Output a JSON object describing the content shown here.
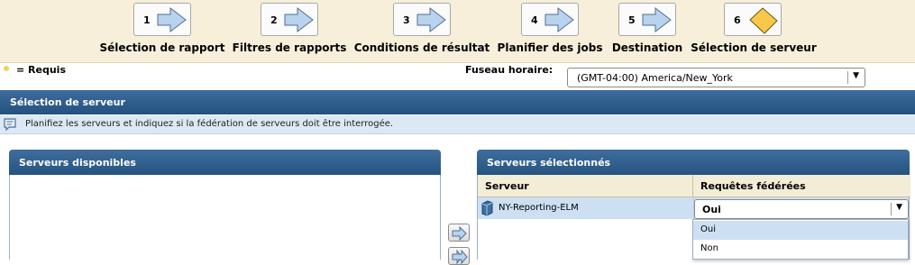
{
  "wizard": {
    "steps": [
      {
        "number": "1",
        "label": "Sélection de rapport",
        "state": "done"
      },
      {
        "number": "2",
        "label": "Filtres de rapports",
        "state": "done"
      },
      {
        "number": "3",
        "label": "Conditions de résultat",
        "state": "done"
      },
      {
        "number": "4",
        "label": "Planifier des jobs",
        "state": "done"
      },
      {
        "number": "5",
        "label": "Destination",
        "state": "done"
      },
      {
        "number": "6",
        "label": "Sélection de serveur",
        "state": "current"
      }
    ]
  },
  "required_legend": "= Requis",
  "timezone": {
    "label": "Fuseau horaire:",
    "value": "(GMT-04:00) America/New_York"
  },
  "section": {
    "title": "Sélection de serveur",
    "hint": "Planifiez les serveurs et indiquez si la fédération de serveurs doit être interrogée."
  },
  "available_servers": {
    "title": "Serveurs disponibles",
    "items": []
  },
  "selected_servers": {
    "title": "Serveurs sélectionnés",
    "columns": {
      "server": "Serveur",
      "federated": "Requêtes fédérées"
    },
    "rows": [
      {
        "server": "NY-Reporting-ELM",
        "federated": "Oui"
      }
    ],
    "federated_options": [
      "Oui",
      "Non"
    ]
  },
  "colors": {
    "wizard_bg": "#f7efd9",
    "header_blue": "#26537f",
    "row_selected": "#cde0f3",
    "step_done_arrow": "#b9d3ee",
    "step_current_arrow": "#f7c84a"
  },
  "icons": {
    "move_right": "arrow-right-icon",
    "move_all_right": "double-arrow-right-icon",
    "server": "server-icon",
    "info": "speech-bubble-icon"
  }
}
